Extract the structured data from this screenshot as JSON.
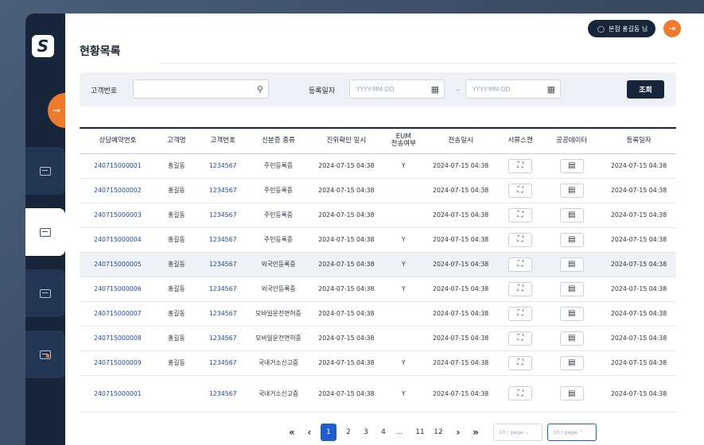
{
  "header": {
    "user_label": "본점 홍길동 님",
    "logo_text": "S"
  },
  "page": {
    "title": "현황목록"
  },
  "search": {
    "customer_no_label": "고객번호",
    "customer_no_value": "",
    "reg_date_label": "등록일자",
    "date_from_placeholder": "YYYY-MM-DD",
    "date_to_placeholder": "YYYY-MM-DD",
    "search_button": "조회"
  },
  "table": {
    "headers": [
      "상담예약번호",
      "고객명",
      "고객번호",
      "신분증 종류",
      "진위확인 일시",
      "EUM\n전송여부",
      "전송일시",
      "서류스캔",
      "공공데이터",
      "등록일자"
    ],
    "rows": [
      [
        "240715000001",
        "홍길동",
        "1234567",
        "주민등록증",
        "2024-07-15 04:38",
        "Y",
        "2024-07-15 04:38",
        "2024-07-15 04:38"
      ],
      [
        "240715000002",
        "홍길동",
        "1234567",
        "주민등록증",
        "2024-07-15 04:38",
        "",
        "2024-07-15 04:38",
        "2024-07-15 04:38"
      ],
      [
        "240715000003",
        "홍길동",
        "1234567",
        "주민등록증",
        "2024-07-15 04:38",
        "",
        "2024-07-15 04:38",
        "2024-07-15 04:38"
      ],
      [
        "240715000004",
        "홍길동",
        "1234567",
        "주민등록증",
        "2024-07-15 04:38",
        "Y",
        "2024-07-15 04:38",
        "2024-07-15 04:38"
      ],
      [
        "240715000005",
        "홍길동",
        "1234567",
        "외국인등록증",
        "2024-07-15 04:38",
        "Y",
        "2024-07-15 04:38",
        "2024-07-15 04:38"
      ],
      [
        "240715000006",
        "홍길동",
        "1234567",
        "외국인등록증",
        "2024-07-15 04:38",
        "Y",
        "2024-07-15 04:38",
        "2024-07-15 04:38"
      ],
      [
        "240715000007",
        "홍길동",
        "1234567",
        "모바일운전면허증",
        "2024-07-15 04:38",
        "",
        "2024-07-15 04:38",
        "2024-07-15 04:38"
      ],
      [
        "240715000008",
        "홍길동",
        "1234567",
        "모바일운전면허증",
        "2024-07-15 04:38",
        "",
        "2024-07-15 04:38",
        "2024-07-15 04:38"
      ],
      [
        "240715000009",
        "홍길동",
        "1234567",
        "국내거소신고증",
        "2024-07-15 04:38",
        "Y",
        "2024-07-15 04:38",
        "2024-07-15 04:38"
      ],
      [
        "240715000001",
        "",
        "1234567",
        "국내거소신고증",
        "2024-07-15 04:38",
        "Y",
        "2024-07-15 04:38",
        "2024-07-15 04:38"
      ]
    ]
  },
  "pagination": {
    "pages": [
      "1",
      "2",
      "3",
      "4",
      "...",
      "11",
      "12"
    ],
    "current": "1",
    "page_size_1": "10 / page",
    "page_size_2": "10 / page"
  },
  "icons": {
    "scan": "scan-icon",
    "public_data": "document-search-icon",
    "user": "user-icon",
    "logout": "logout-icon",
    "search": "search-icon",
    "calendar": "calendar-icon"
  },
  "colors": {
    "navy": "#17253a",
    "orange": "#f07a2b",
    "link": "#1f4aa0",
    "active_page": "#1f5bd1"
  }
}
